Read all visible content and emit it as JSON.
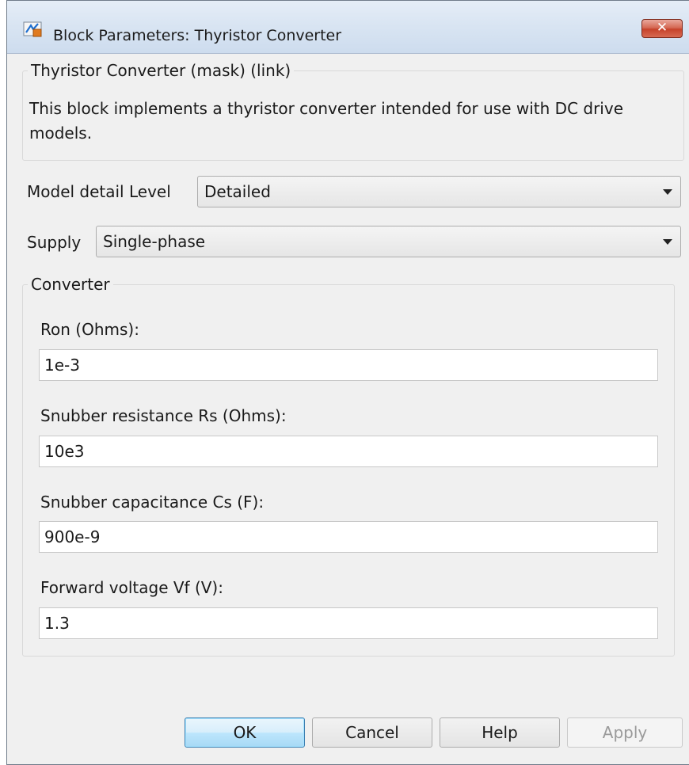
{
  "window": {
    "title": "Block Parameters: Thyristor Converter",
    "close_label": "✕"
  },
  "description_group": {
    "legend": "Thyristor Converter (mask) (link)",
    "text": "This block implements a thyristor converter intended for use with DC drive models."
  },
  "model_detail": {
    "label": "Model detail Level",
    "value": "Detailed"
  },
  "supply": {
    "label": "Supply",
    "value": "Single-phase"
  },
  "converter": {
    "legend": "Converter",
    "fields": [
      {
        "label": "Ron (Ohms):",
        "value": "1e-3"
      },
      {
        "label": "Snubber resistance Rs (Ohms):",
        "value": "10e3"
      },
      {
        "label": "Snubber capacitance Cs (F):",
        "value": "900e-9"
      },
      {
        "label": "Forward voltage Vf (V):",
        "value": "1.3"
      }
    ]
  },
  "buttons": {
    "ok": "OK",
    "cancel": "Cancel",
    "help": "Help",
    "apply": "Apply"
  },
  "colors": {
    "dialog_bg": "#f0f0f0",
    "close_red": "#c6422a",
    "default_button_border": "#3c7fb1"
  }
}
